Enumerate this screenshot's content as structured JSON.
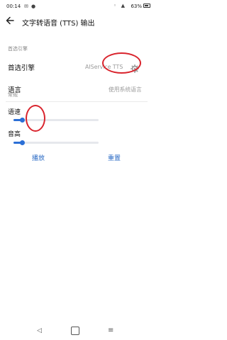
{
  "status_bar": {
    "time": "00:14",
    "battery": "63%"
  },
  "header": {
    "title": "文字转语音 (TTS) 输出"
  },
  "preferred_engine_section": {
    "label": "首选引擎",
    "engine_row": {
      "label": "首选引擎",
      "value": "AIService TTS"
    },
    "language_row": {
      "label": "语言",
      "value": "使用系统语言"
    }
  },
  "general_section": {
    "label": "常规",
    "speech_rate": {
      "label": "语速",
      "level": 0.1
    },
    "pitch": {
      "label": "音高",
      "level": 0.1
    }
  },
  "actions": {
    "play": "播放",
    "reset": "重置"
  },
  "colors": {
    "accent": "#2b6fd6",
    "annotation": "#d9242d"
  }
}
